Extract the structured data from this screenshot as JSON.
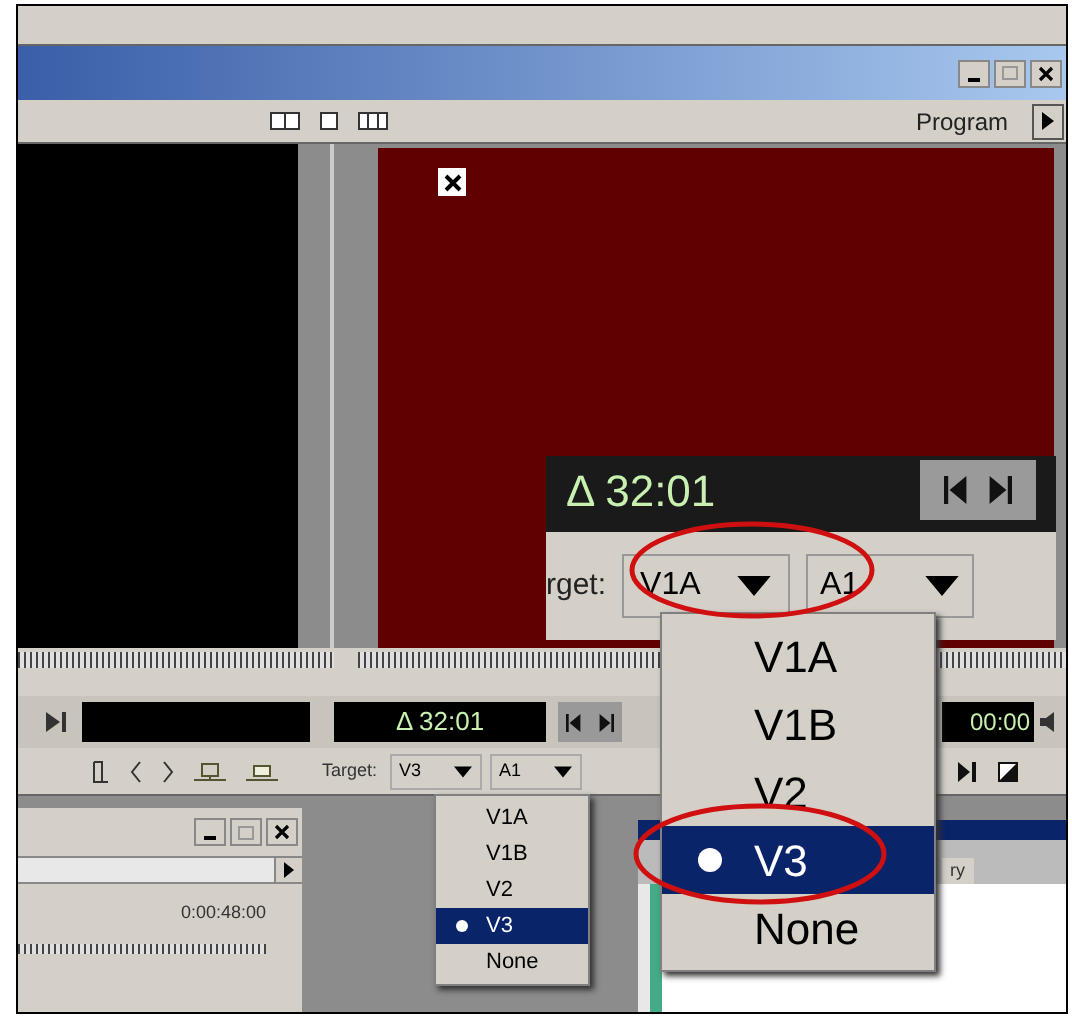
{
  "toolbar": {
    "monitor_label": "Program"
  },
  "program_monitor": {
    "timecode": "Δ 32:01",
    "end_timecode": "00:00",
    "target_label": "Target:",
    "video_target": "V3",
    "audio_target": "A1"
  },
  "target_menu": {
    "items": [
      {
        "label": "V1A",
        "selected": false
      },
      {
        "label": "V1B",
        "selected": false
      },
      {
        "label": "V2",
        "selected": false
      },
      {
        "label": "V3",
        "selected": true
      },
      {
        "label": "None",
        "selected": false
      }
    ]
  },
  "timeline": {
    "timecode": "0:00:48:00"
  },
  "lower_right_panel": {
    "tab": "ry"
  },
  "zoom_inset": {
    "timecode": "Δ 32:01",
    "target_label": "rget:",
    "video_target": "V1A",
    "audio_target": "A1",
    "menu": {
      "items": [
        {
          "label": "V1A",
          "selected": false
        },
        {
          "label": "V1B",
          "selected": false
        },
        {
          "label": "V2",
          "selected": false
        },
        {
          "label": "V3",
          "selected": true
        },
        {
          "label": "None",
          "selected": false
        }
      ]
    }
  }
}
